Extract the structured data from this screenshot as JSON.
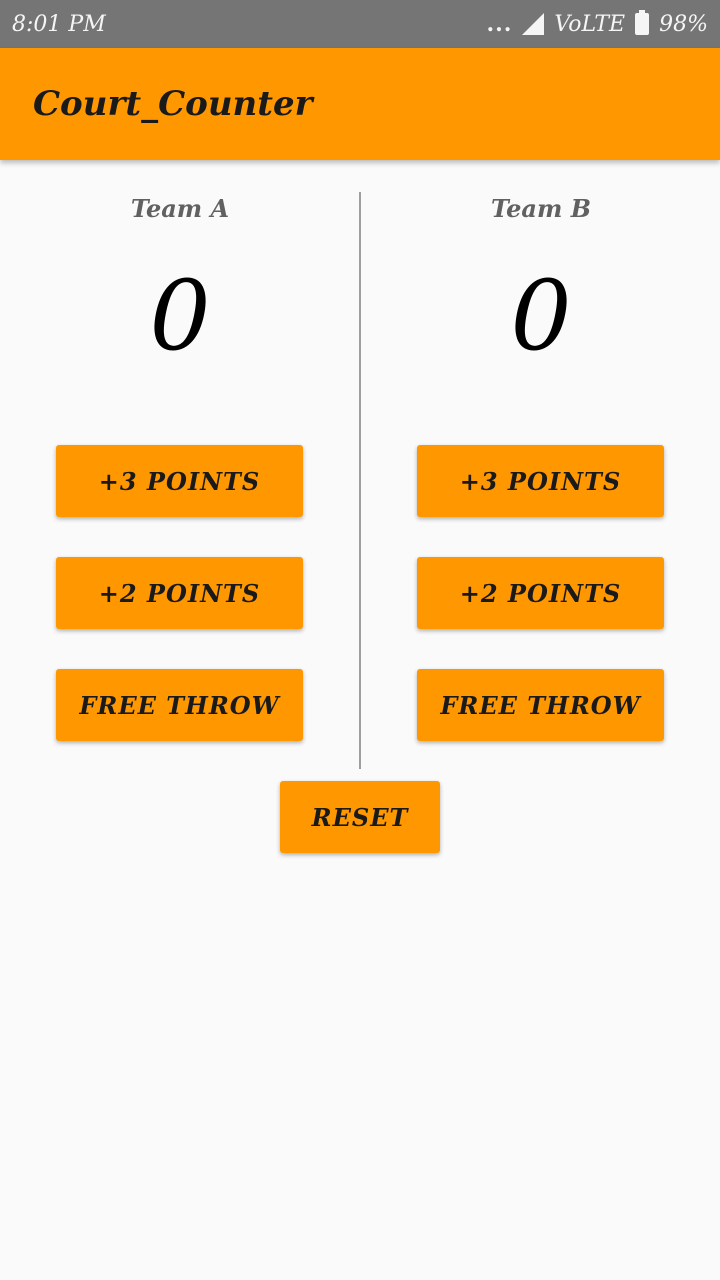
{
  "status_bar": {
    "time": "8:01 PM",
    "dots": "...",
    "network": "VoLTE",
    "battery": "98%"
  },
  "app_bar": {
    "title": "Court_Counter"
  },
  "team_a": {
    "name": "Team A",
    "score": "0",
    "plus3_label": "+3 POINTS",
    "plus2_label": "+2 POINTS",
    "free_throw_label": "FREE THROW"
  },
  "team_b": {
    "name": "Team B",
    "score": "0",
    "plus3_label": "+3 POINTS",
    "plus2_label": "+2 POINTS",
    "free_throw_label": "FREE THROW"
  },
  "reset_label": "RESET",
  "colors": {
    "accent": "#ff9800",
    "status_bar": "#757575",
    "background": "#fafafa",
    "divider": "#9e9e9e"
  }
}
